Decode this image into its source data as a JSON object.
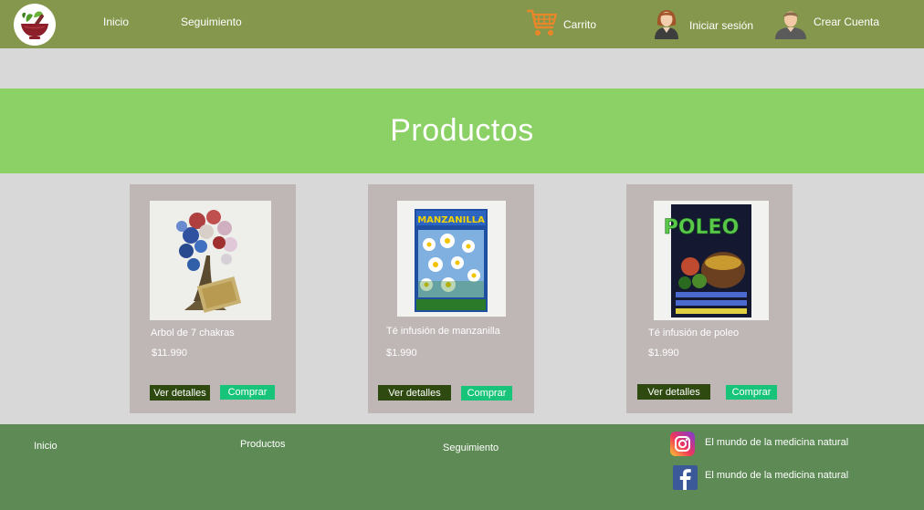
{
  "header": {
    "nav": {
      "home": "Inicio",
      "tracking": "Seguimiento"
    },
    "cart_label": "Carrito",
    "login_label": "Iniciar sesión",
    "signup_label": "Crear Cuenta"
  },
  "banner": {
    "title": "Productos"
  },
  "products": [
    {
      "name": "Arbol de 7 chakras",
      "price": "$11.990",
      "details_label": "Ver detalles",
      "buy_label": "Comprar"
    },
    {
      "name": "Té infusión de manzanilla",
      "price": "$1.990",
      "details_label": "Ver detalles",
      "buy_label": "Comprar",
      "package_text": "MANZANILLA"
    },
    {
      "name": "Té infusión de poleo",
      "price": "$1.990",
      "details_label": "Ver detalles",
      "buy_label": "Comprar",
      "package_text": "POLEO"
    }
  ],
  "footer": {
    "home": "Inicio",
    "products": "Productos",
    "tracking": "Seguimiento",
    "instagram_label": "El mundo de la medicina natural",
    "facebook_label": "El mundo de la medicina natural"
  },
  "colors": {
    "header_bg": "#85974c",
    "banner_bg": "#8bd165",
    "page_bg": "#d8d8d8",
    "card_bg": "#bfb6b6",
    "details_btn": "#2e4a10",
    "buy_btn": "#18c47a",
    "footer_bg": "#5d8a55",
    "cart_icon": "#e8872a"
  },
  "icons": [
    "logo-mortar-leaves",
    "cart-icon",
    "female-avatar-icon",
    "male-avatar-icon",
    "instagram-icon",
    "facebook-icon"
  ]
}
